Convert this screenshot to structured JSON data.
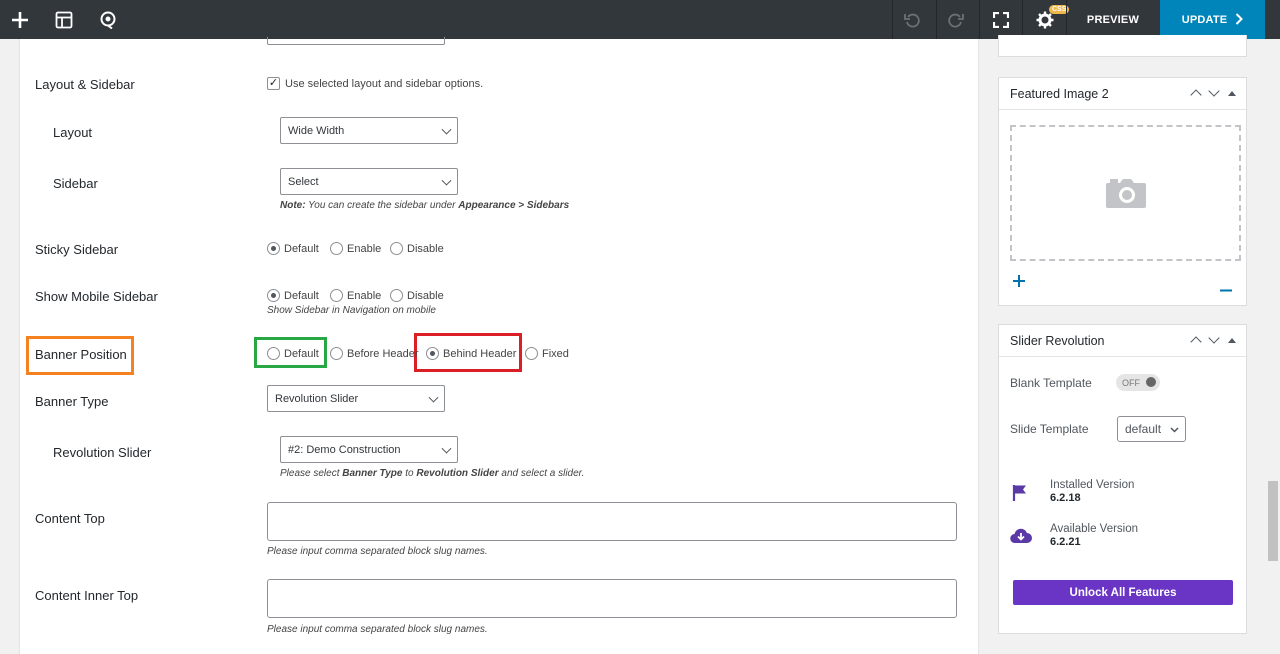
{
  "toolbar": {
    "add_icon": "plus-icon",
    "layout_icon": "layout-icon",
    "navigator_icon": "navigator-icon",
    "undo_icon": "undo-icon",
    "redo_icon": "redo-icon",
    "fullscreen_icon": "fullscreen-icon",
    "settings_icon": "gear-icon",
    "css_badge": "CSS",
    "preview_label": "PREVIEW",
    "update_label": "UPDATE",
    "update_color": "#0085ba"
  },
  "form": {
    "layout_sidebar": {
      "label": "Layout & Sidebar",
      "checkbox_label": "Use selected layout and sidebar options.",
      "checked": true
    },
    "layout": {
      "label": "Layout",
      "value": "Wide Width"
    },
    "sidebar": {
      "label": "Sidebar",
      "value": "Select",
      "note_prefix": "Note:",
      "note_text": " You can create the sidebar under ",
      "note_path": "Appearance > Sidebars"
    },
    "sticky_sidebar": {
      "label": "Sticky Sidebar",
      "options": [
        "Default",
        "Enable",
        "Disable"
      ],
      "selected": "Default"
    },
    "mobile_sidebar": {
      "label": "Show Mobile Sidebar",
      "options": [
        "Default",
        "Enable",
        "Disable"
      ],
      "selected": "Default",
      "note": "Show Sidebar in Navigation on mobile"
    },
    "banner_position": {
      "label": "Banner Position",
      "options": [
        "Default",
        "Before Header",
        "Behind Header",
        "Fixed"
      ],
      "selected": "Behind Header"
    },
    "banner_type": {
      "label": "Banner Type",
      "value": "Revolution Slider"
    },
    "revolution_slider": {
      "label": "Revolution Slider",
      "value": "#2: Demo Construction",
      "note_a": "Please select ",
      "note_b": "Banner Type",
      "note_c": " to ",
      "note_d": "Revolution Slider",
      "note_e": " and select a slider."
    },
    "content_top": {
      "label": "Content Top",
      "note": "Please input comma separated block slug names."
    },
    "content_inner_top": {
      "label": "Content Inner Top",
      "note": "Please input comma separated block slug names."
    }
  },
  "highlights": {
    "orange": "#f58220",
    "green": "#28a745",
    "red": "#dc1f26"
  },
  "featured_image": {
    "title": "Featured Image 2",
    "placeholder_icon": "camera-icon",
    "add_icon": "plus-icon",
    "remove_icon": "minus-icon"
  },
  "slider_revolution": {
    "title": "Slider Revolution",
    "blank_template_label": "Blank Template",
    "blank_template_state": "OFF",
    "slide_template_label": "Slide Template",
    "slide_template_value": "default",
    "installed_label": "Installed Version",
    "installed_version": "6.2.18",
    "available_label": "Available Version",
    "available_version": "6.2.21",
    "unlock_label": "Unlock All Features",
    "accent": "#6a34c5"
  }
}
